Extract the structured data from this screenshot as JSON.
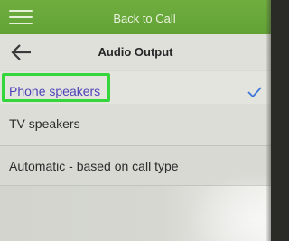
{
  "topbar": {
    "title": "Back to Call",
    "menu_icon": "hamburger-menu-icon"
  },
  "header": {
    "title": "Audio Output",
    "back_icon": "arrow-left-icon"
  },
  "options": [
    {
      "label": "Phone speakers",
      "selected": true
    },
    {
      "label": "TV speakers",
      "selected": false
    },
    {
      "label": "Automatic - based on call type",
      "selected": false
    }
  ],
  "colors": {
    "topbar": "#66a637",
    "selected_text": "#4d43b8",
    "checkmark": "#3d78d8",
    "highlight_box": "#35d63c"
  },
  "icons": {
    "selected_indicator": "checkmark-icon"
  }
}
